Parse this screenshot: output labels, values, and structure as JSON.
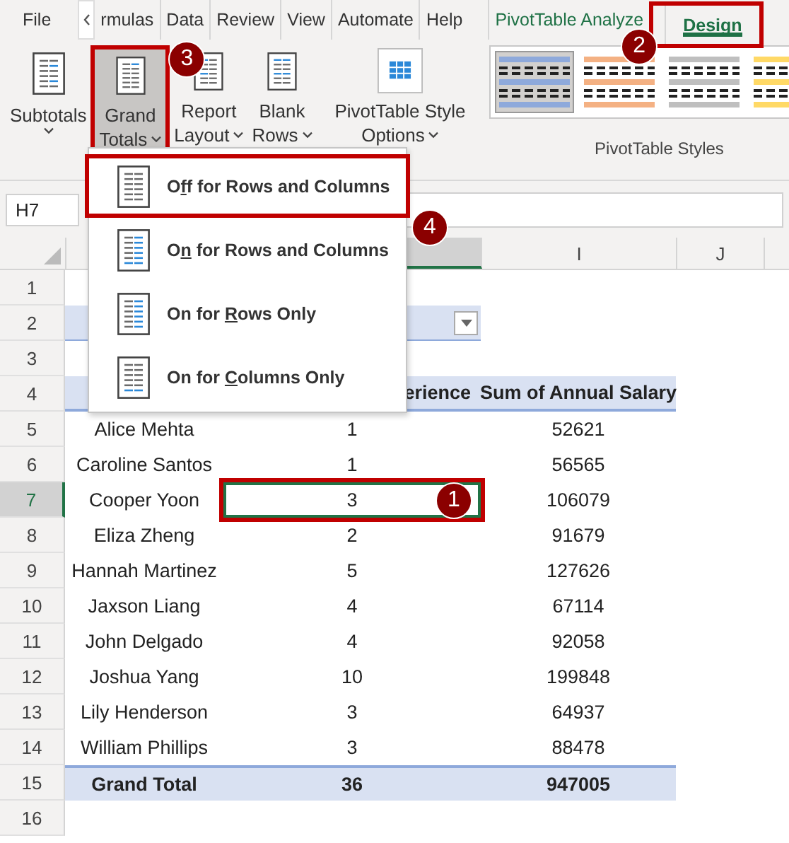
{
  "ribbon_tabs": [
    {
      "label": "File",
      "kind": "standard",
      "selected": false
    },
    {
      "label": "rmulas",
      "kind": "standard",
      "selected": false
    },
    {
      "label": "Data",
      "kind": "standard",
      "selected": false
    },
    {
      "label": "Review",
      "kind": "standard",
      "selected": false
    },
    {
      "label": "View",
      "kind": "standard",
      "selected": false
    },
    {
      "label": "Automate",
      "kind": "standard",
      "selected": false
    },
    {
      "label": "Help",
      "kind": "standard",
      "selected": false
    },
    {
      "label": "PivotTable Analyze",
      "kind": "contextual",
      "selected": false
    },
    {
      "label": "Design",
      "kind": "contextual",
      "selected": true,
      "badge": "2"
    }
  ],
  "ribbon_buttons": [
    {
      "lines": [
        "Subtotals"
      ],
      "pressed": false
    },
    {
      "lines": [
        "Grand",
        "Totals"
      ],
      "pressed": true,
      "badge": "3"
    },
    {
      "lines": [
        "Report",
        "Layout"
      ],
      "pressed": false
    },
    {
      "lines": [
        "Blank",
        "Rows"
      ],
      "pressed": false
    }
  ],
  "style_options_button": {
    "lines": [
      "PivotTable Style",
      "Options"
    ]
  },
  "styles_gallery": {
    "label": "PivotTable Styles",
    "styles": [
      {
        "color": "#8ea9db",
        "selected": true
      },
      {
        "color": "#f4b183",
        "selected": false
      },
      {
        "color": "#bfbfbf",
        "selected": false
      },
      {
        "color": "#ffd966",
        "selected": false
      }
    ]
  },
  "name_box": "H7",
  "column_headers": [
    {
      "selected": true
    },
    {
      "label": "I",
      "selected": false
    },
    {
      "label": "J",
      "selected": false
    }
  ],
  "sheet_rows": [
    {
      "number": "1",
      "selected": false,
      "kind": "blank"
    },
    {
      "number": "2",
      "selected": false,
      "kind": "filter"
    },
    {
      "number": "3",
      "selected": false,
      "kind": "blank"
    },
    {
      "number": "4",
      "selected": false,
      "kind": "header",
      "cells": [
        "erience",
        "Sum of Annual Salary"
      ]
    },
    {
      "number": "5",
      "selected": false,
      "kind": "data",
      "cells": [
        "Alice Mehta",
        "1",
        "52621"
      ]
    },
    {
      "number": "6",
      "selected": false,
      "kind": "data",
      "cells": [
        "Caroline Santos",
        "1",
        "56565"
      ]
    },
    {
      "number": "7",
      "selected": true,
      "kind": "data",
      "cells": [
        "Cooper Yoon",
        "3",
        "106079"
      ],
      "badge": "1"
    },
    {
      "number": "8",
      "selected": false,
      "kind": "data",
      "cells": [
        "Eliza Zheng",
        "2",
        "91679"
      ]
    },
    {
      "number": "9",
      "selected": false,
      "kind": "data",
      "cells": [
        "Hannah Martinez",
        "5",
        "127626"
      ]
    },
    {
      "number": "10",
      "selected": false,
      "kind": "data",
      "cells": [
        "Jaxson Liang",
        "4",
        "67114"
      ]
    },
    {
      "number": "11",
      "selected": false,
      "kind": "data",
      "cells": [
        "John Delgado",
        "4",
        "92058"
      ]
    },
    {
      "number": "12",
      "selected": false,
      "kind": "data",
      "cells": [
        "Joshua Yang",
        "10",
        "199848"
      ]
    },
    {
      "number": "13",
      "selected": false,
      "kind": "data",
      "cells": [
        "Lily Henderson",
        "3",
        "64937"
      ]
    },
    {
      "number": "14",
      "selected": false,
      "kind": "data",
      "cells": [
        "William Phillips",
        "3",
        "88478"
      ]
    },
    {
      "number": "15",
      "selected": false,
      "kind": "total",
      "cells": [
        "Grand Total",
        "36",
        "947005"
      ]
    },
    {
      "number": "16",
      "selected": false,
      "kind": "blank"
    }
  ],
  "grand_totals_menu": [
    {
      "label_parts": [
        "O",
        "f",
        "f for Rows and Columns"
      ],
      "badge": "4"
    },
    {
      "label_parts": [
        "O",
        "n",
        " for Rows and Columns"
      ]
    },
    {
      "label_parts": [
        "On for ",
        "R",
        "ows Only"
      ]
    },
    {
      "label_parts": [
        "On for ",
        "C",
        "olumns Only"
      ]
    }
  ]
}
